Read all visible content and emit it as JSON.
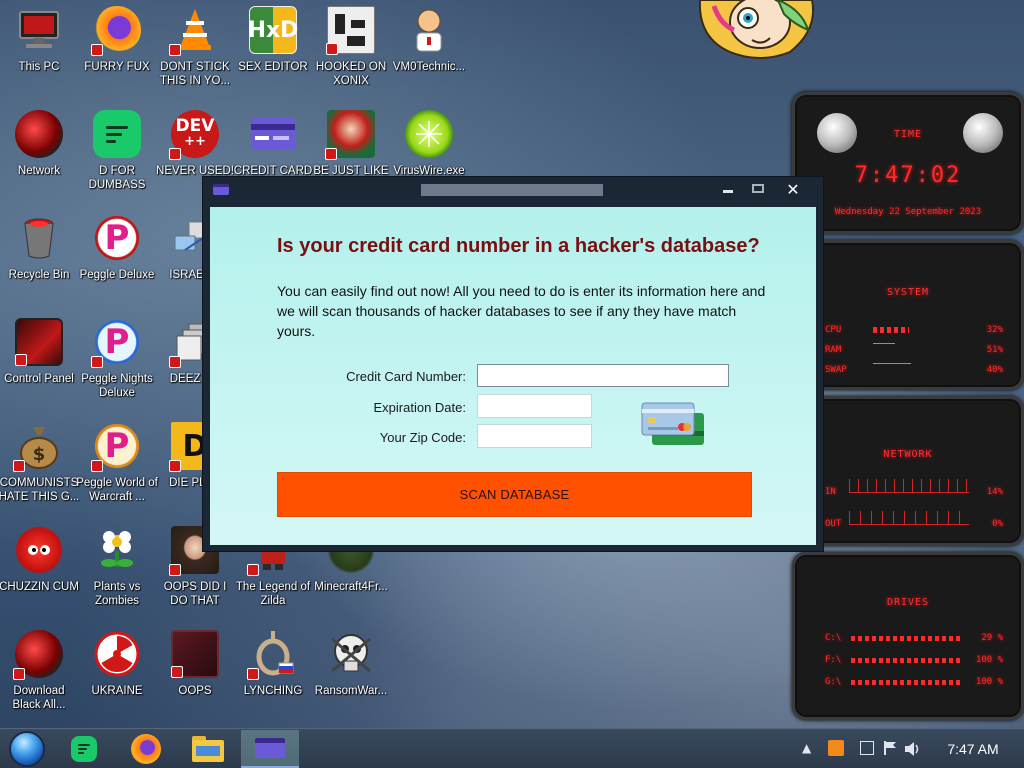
{
  "desktop": {
    "icons": [
      {
        "label": "This PC"
      },
      {
        "label": "FURRY FUX"
      },
      {
        "label": "DONT STICK THIS IN YO..."
      },
      {
        "label": "SEX EDITOR"
      },
      {
        "label": "HOOKED ON XONIX"
      },
      {
        "label": "VM0Technic..."
      },
      {
        "label": "Network"
      },
      {
        "label": "D FOR DUMBASS"
      },
      {
        "label": "NEVER USED!"
      },
      {
        "label": "CREDIT CARD CHECKER"
      },
      {
        "label": "BE JUST LIKE THE DUDE!"
      },
      {
        "label": "VirusWire.exe"
      },
      {
        "label": "Recycle Bin"
      },
      {
        "label": "Peggle Deluxe"
      },
      {
        "label": "ISRAEL S"
      },
      {
        "label": "Control Panel"
      },
      {
        "label": "Peggle Nights Deluxe"
      },
      {
        "label": "DEEZ NU"
      },
      {
        "label": "COMMUNISTS HATE THIS G..."
      },
      {
        "label": "Peggle World of Warcraft ..."
      },
      {
        "label": "DIE PLEA"
      },
      {
        "label": "CHUZZIN CUM"
      },
      {
        "label": "Plants vs Zombies"
      },
      {
        "label": "OOPS DID I DO THAT"
      },
      {
        "label": "The Legend of Zilda"
      },
      {
        "label": "Minecraft4Fr..."
      },
      {
        "label": "Download Black All..."
      },
      {
        "label": "UKRAINE"
      },
      {
        "label": "OOPS"
      },
      {
        "label": "LYNCHING"
      },
      {
        "label": "RansomWar..."
      }
    ],
    "dev_icon_text": "DEV\n++"
  },
  "widgets": {
    "time": {
      "title": "TIME",
      "clock": "7:47:02",
      "date": "Wednesday 22 September 2023"
    },
    "system": {
      "title": "SYSTEM",
      "rows": [
        {
          "label": "CPU",
          "value": "32%"
        },
        {
          "label": "RAM",
          "value": "51%"
        },
        {
          "label": "SWAP",
          "value": "40%"
        }
      ]
    },
    "network": {
      "title": "NETWORK",
      "rows": [
        {
          "label": "IN",
          "value": "14%"
        },
        {
          "label": "OUT",
          "value": "0%"
        }
      ]
    },
    "drives": {
      "title": "DRIVES",
      "rows": [
        {
          "label": "C:\\",
          "value": "29 %"
        },
        {
          "label": "F:\\",
          "value": "100 %"
        },
        {
          "label": "G:\\",
          "value": "100 %"
        }
      ]
    }
  },
  "dialog": {
    "heading": "Is your credit card number in a hacker's database?",
    "intro": "You can easily find out now! All you need to do is enter its information here and we will scan thousands of hacker databases to see if any they have match yours.",
    "fields": {
      "card_number_label": "Credit Card Number:",
      "card_number_value": "",
      "expiration_label": "Expiration Date:",
      "expiration_value": "",
      "zip_label": "Your Zip Code:",
      "zip_value": ""
    },
    "button_label": "SCAN DATABASE",
    "accent": "#ff5100",
    "heading_color": "#7a0f12"
  },
  "taskbar": {
    "clock": "7:47 AM"
  }
}
